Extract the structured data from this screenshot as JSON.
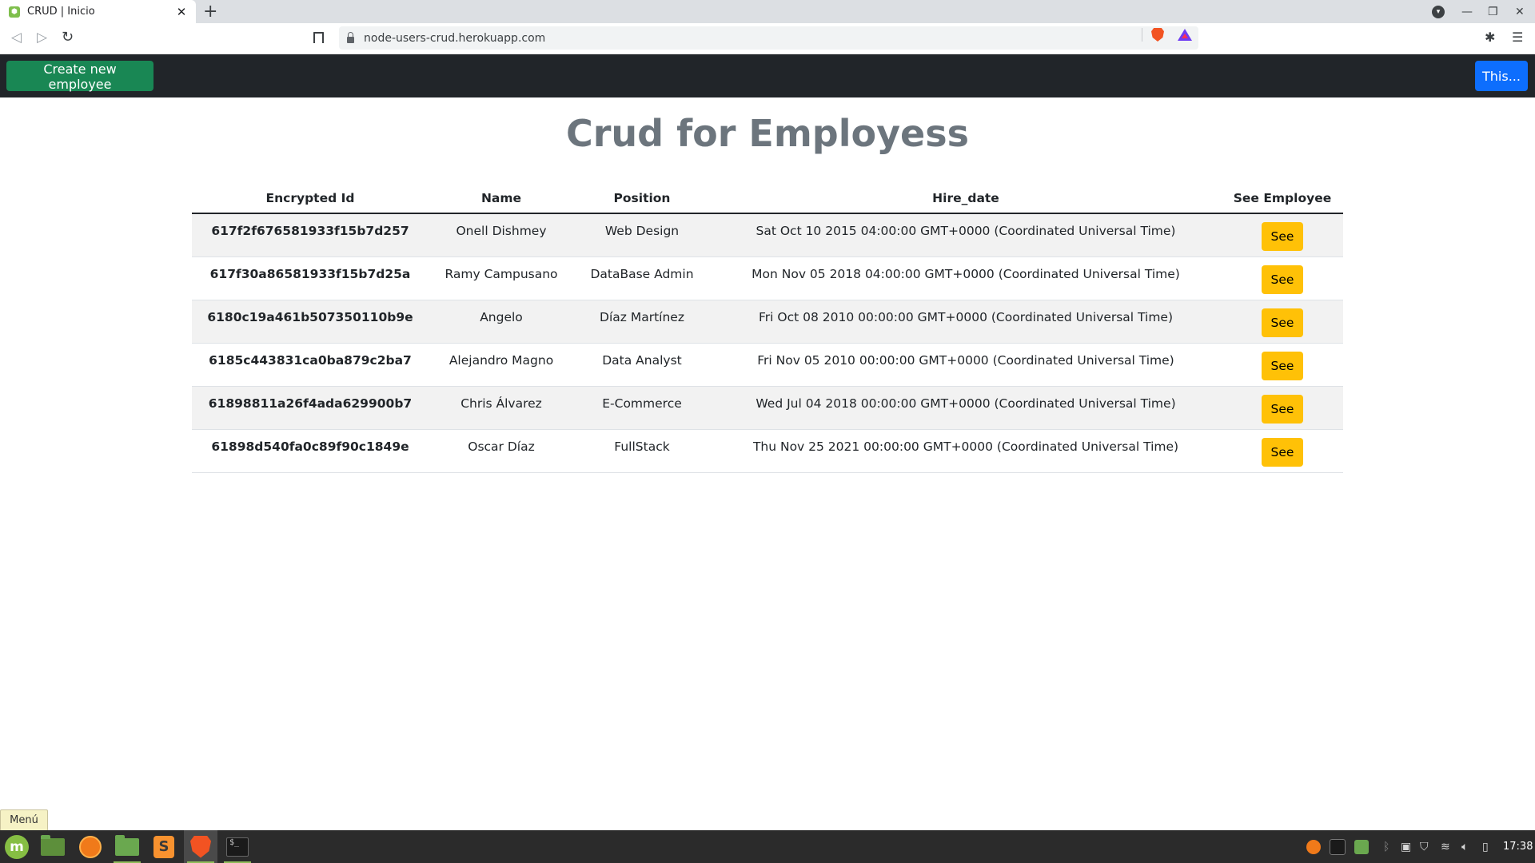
{
  "browser": {
    "tab_title": "CRUD | Inicio",
    "tab_close": "✕",
    "new_tab": "+",
    "url": "node-users-crud.herokuapp.com"
  },
  "navbar": {
    "create_button": "Create new employee",
    "right_button": "This..."
  },
  "page": {
    "title": "Crud for Employess"
  },
  "table": {
    "headers": {
      "id": "Encrypted Id",
      "name": "Name",
      "position": "Position",
      "hire_date": "Hire_date",
      "see": "See Employee"
    },
    "see_label": "See",
    "rows": [
      {
        "id": "617f2f676581933f15b7d257",
        "name": "Onell Dishmey",
        "position": "Web Design",
        "hire_date": "Sat Oct 10 2015 04:00:00 GMT+0000 (Coordinated Universal Time)"
      },
      {
        "id": "617f30a86581933f15b7d25a",
        "name": "Ramy Campusano",
        "position": "DataBase Admin",
        "hire_date": "Mon Nov 05 2018 04:00:00 GMT+0000 (Coordinated Universal Time)"
      },
      {
        "id": "6180c19a461b507350110b9e",
        "name": "Angelo",
        "position": "Díaz Martínez",
        "hire_date": "Fri Oct 08 2010 00:00:00 GMT+0000 (Coordinated Universal Time)"
      },
      {
        "id": "6185c443831ca0ba879c2ba7",
        "name": "Alejandro Magno",
        "position": "Data Analyst",
        "hire_date": "Fri Nov 05 2010 00:00:00 GMT+0000 (Coordinated Universal Time)"
      },
      {
        "id": "61898811a26f4ada629900b7",
        "name": "Chris Álvarez",
        "position": "E-Commerce",
        "hire_date": "Wed Jul 04 2018 00:00:00 GMT+0000 (Coordinated Universal Time)"
      },
      {
        "id": "61898d540fa0c89f90c1849e",
        "name": "Oscar Díaz",
        "position": "FullStack",
        "hire_date": "Thu Nov 25 2021 00:00:00 GMT+0000 (Coordinated Universal Time)"
      }
    ]
  },
  "taskbar": {
    "menu_tooltip": "Menú",
    "clock": "17:38"
  },
  "colors": {
    "navbar_bg": "#212529",
    "create_button_bg": "#198754",
    "right_button_bg": "#0d6efd",
    "see_button_bg": "#ffc107",
    "title_color": "#6c757d",
    "stripe_bg": "#f2f2f2"
  }
}
